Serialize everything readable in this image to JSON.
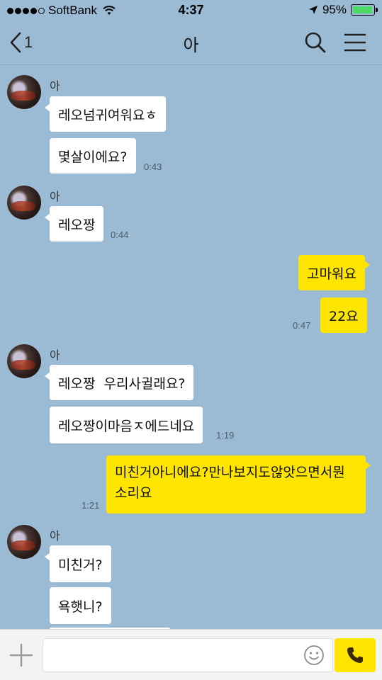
{
  "status_bar": {
    "carrier": "SoftBank",
    "time": "4:37",
    "battery_percent": "95%",
    "battery_level": 0.95,
    "signal_bars": 4
  },
  "header": {
    "back_count": "1",
    "title": "아"
  },
  "messages": [
    {
      "id": "m1",
      "sender": "아",
      "text": "레오넘귀여워요ㅎ",
      "time": ""
    },
    {
      "id": "m2",
      "sender": "아",
      "text": "몇살이에요?",
      "time": "0:43"
    },
    {
      "id": "m3",
      "sender": "아",
      "text": "레오짱",
      "time": "0:44"
    },
    {
      "id": "m4",
      "sender": "me",
      "text": "고마워요",
      "time": ""
    },
    {
      "id": "m5",
      "sender": "me",
      "text": "22요",
      "time": "0:47"
    },
    {
      "id": "m6",
      "sender": "아",
      "text": "레오짱  우리사귈래요?",
      "time": ""
    },
    {
      "id": "m7",
      "sender": "아",
      "text": "레오짱이마음ㅈ에드네요",
      "time": "1:19"
    },
    {
      "id": "m8",
      "sender": "me",
      "text": "미친거아니에요?만나보지도않앗으면서뭔소리요",
      "time": "1:21"
    },
    {
      "id": "m9",
      "sender": "아",
      "text": "미친거?",
      "time": ""
    },
    {
      "id": "m10",
      "sender": "아",
      "text": "욕햇니?",
      "time": ""
    }
  ],
  "input": {
    "value": "",
    "placeholder": ""
  },
  "colors": {
    "chat_background": "#9bbbd4",
    "my_bubble": "#fee500",
    "their_bubble": "#ffffff",
    "battery": "#4cd964"
  }
}
